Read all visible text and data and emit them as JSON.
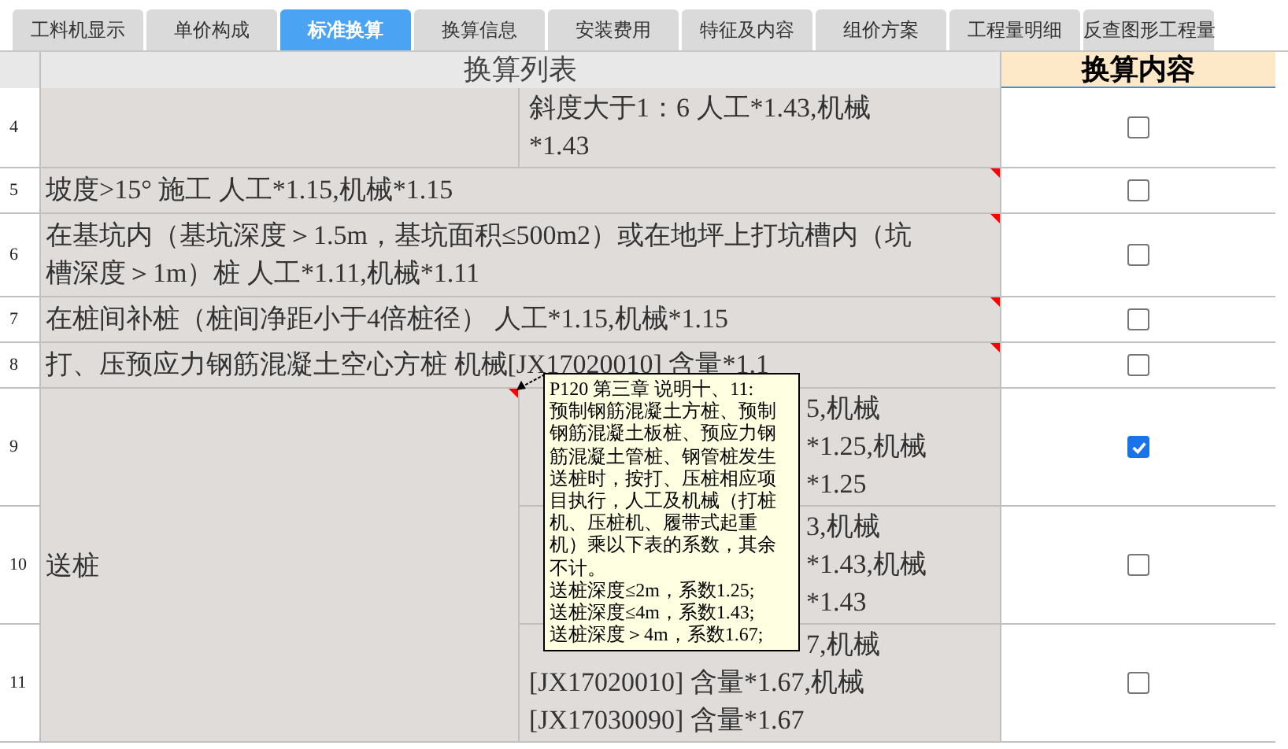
{
  "tabs": [
    {
      "label": "工料机显示",
      "selected": false
    },
    {
      "label": "单价构成",
      "selected": false
    },
    {
      "label": "标准换算",
      "selected": true
    },
    {
      "label": "换算信息",
      "selected": false
    },
    {
      "label": "安装费用",
      "selected": false
    },
    {
      "label": "特征及内容",
      "selected": false
    },
    {
      "label": "组价方案",
      "selected": false
    },
    {
      "label": "工程量明细",
      "selected": false
    },
    {
      "label": "反查图形工程量",
      "selected": false
    }
  ],
  "table": {
    "columns": [
      "换算列表",
      "换算内容"
    ],
    "groups": [
      {
        "kind": "split",
        "has_note": false,
        "rows": [
          {
            "number": "4",
            "checked": false,
            "sub_lines": [
              "斜度大于1：6 人工*1.43,机械",
              "*1.43"
            ]
          }
        ]
      },
      {
        "kind": "full",
        "has_note": true,
        "text": "坡度>15° 施工 人工*1.15,机械*1.15",
        "rows": [
          {
            "number": "5",
            "checked": false
          }
        ]
      },
      {
        "kind": "full",
        "has_note": true,
        "text": "在基坑内（基坑深度＞1.5m，基坑面积≤500m2）或在地坪上打坑槽内（坑槽深度＞1m）桩 人工*1.11,机械*1.11",
        "rows": [
          {
            "number": "6",
            "checked": false
          }
        ]
      },
      {
        "kind": "full",
        "has_note": true,
        "text": "在桩间补桩（桩间净距小于4倍桩径） 人工*1.15,机械*1.15",
        "rows": [
          {
            "number": "7",
            "checked": false
          }
        ]
      },
      {
        "kind": "full",
        "has_note": true,
        "text": "打、压预应力钢筋混凝土空心方桩 机械[JX17020010] 含量*1.1",
        "rows": [
          {
            "number": "8",
            "checked": false
          }
        ]
      },
      {
        "kind": "split",
        "has_note": true,
        "text": "送桩",
        "rows": [
          {
            "number": "9",
            "checked": true,
            "lines_beside_note": [
              "5,机械",
              "*1.25,机械",
              "*1.25"
            ]
          },
          {
            "number": "10",
            "checked": false,
            "lines_beside_note": [
              "3,机械",
              "*1.43,机械",
              "*1.43"
            ]
          },
          {
            "number": "11",
            "checked": false,
            "lines_beside_note": [
              "7,机械"
            ],
            "sub_lines": [
              "[JX17020010] 含量*1.67,机械",
              "[JX17030090] 含量*1.67"
            ]
          }
        ]
      }
    ]
  },
  "note": {
    "lines": [
      "P120 第三章 说明十、11:",
      "预制钢筋混凝土方桩、预制",
      "钢筋混凝土板桩、预应力钢",
      "筋混凝土管桩、钢管桩发生",
      "送桩时，按打、压桩相应项",
      "目执行，人工及机械（打桩",
      "机、压桩机、履带式起重",
      "机）乘以下表的系数，其余",
      "不计。",
      "送桩深度≤2m，系数1.25;",
      "送桩深度≤4m，系数1.43;",
      "送桩深度＞4m，系数1.67;"
    ]
  }
}
